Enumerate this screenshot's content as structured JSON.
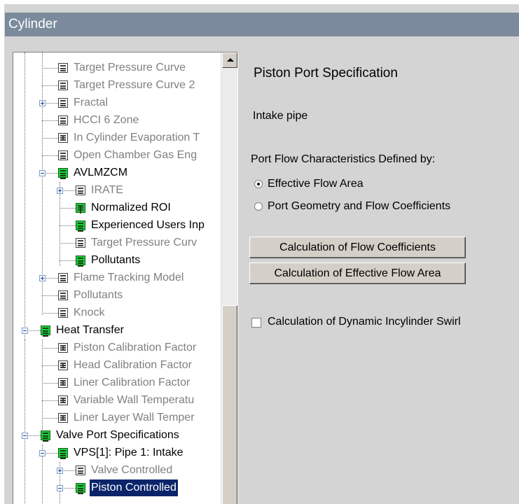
{
  "window": {
    "title": "Cylinder"
  },
  "tree": {
    "items": [
      {
        "label": "Target Pressure Curve"
      },
      {
        "label": "Target Pressure Curve 2"
      },
      {
        "label": "Fractal"
      },
      {
        "label": "HCCI 6 Zone"
      },
      {
        "label": "In Cylinder Evaporation T"
      },
      {
        "label": "Open Chamber Gas Eng"
      },
      {
        "label": "AVLMZCM"
      },
      {
        "label": "IRATE"
      },
      {
        "label": "Normalized ROI"
      },
      {
        "label": "Experienced Users Inp"
      },
      {
        "label": "Target Pressure Curv"
      },
      {
        "label": "Pollutants"
      },
      {
        "label": "Flame Tracking Model"
      },
      {
        "label": "Pollutants"
      },
      {
        "label": "Knock"
      },
      {
        "label": "Heat Transfer"
      },
      {
        "label": "Piston Calibration Factor"
      },
      {
        "label": "Head Calibration Factor"
      },
      {
        "label": "Liner Calibration Factor"
      },
      {
        "label": "Variable Wall Temperatu"
      },
      {
        "label": "Liner Layer Wall Temper"
      },
      {
        "label": "Valve Port Specifications"
      },
      {
        "label": "VPS[1]: Pipe 1: Intake"
      },
      {
        "label": "Valve Controlled"
      },
      {
        "label": "Piston Controlled"
      }
    ]
  },
  "panel": {
    "title": "Piston Port Specification",
    "pipe_label": "Intake pipe",
    "flow_defined_by_label": "Port Flow Characteristics Defined by:",
    "radio_options": [
      {
        "label": "Effective Flow Area",
        "checked": true
      },
      {
        "label": "Port Geometry and Flow Coefficients",
        "checked": false
      }
    ],
    "buttons": {
      "flow_coefficients": "Calculation of Flow Coefficients",
      "effective_flow_area": "Calculation of Effective Flow Area"
    },
    "swirl_checkbox_label": "Calculation of Dynamic Incylinder Swirl",
    "swirl_checked": false
  },
  "colors": {
    "title_bar": "#7b8a9d",
    "panel_bg": "#d4d4d4",
    "node_green": "#19d23a",
    "selection": "#0a246a"
  }
}
